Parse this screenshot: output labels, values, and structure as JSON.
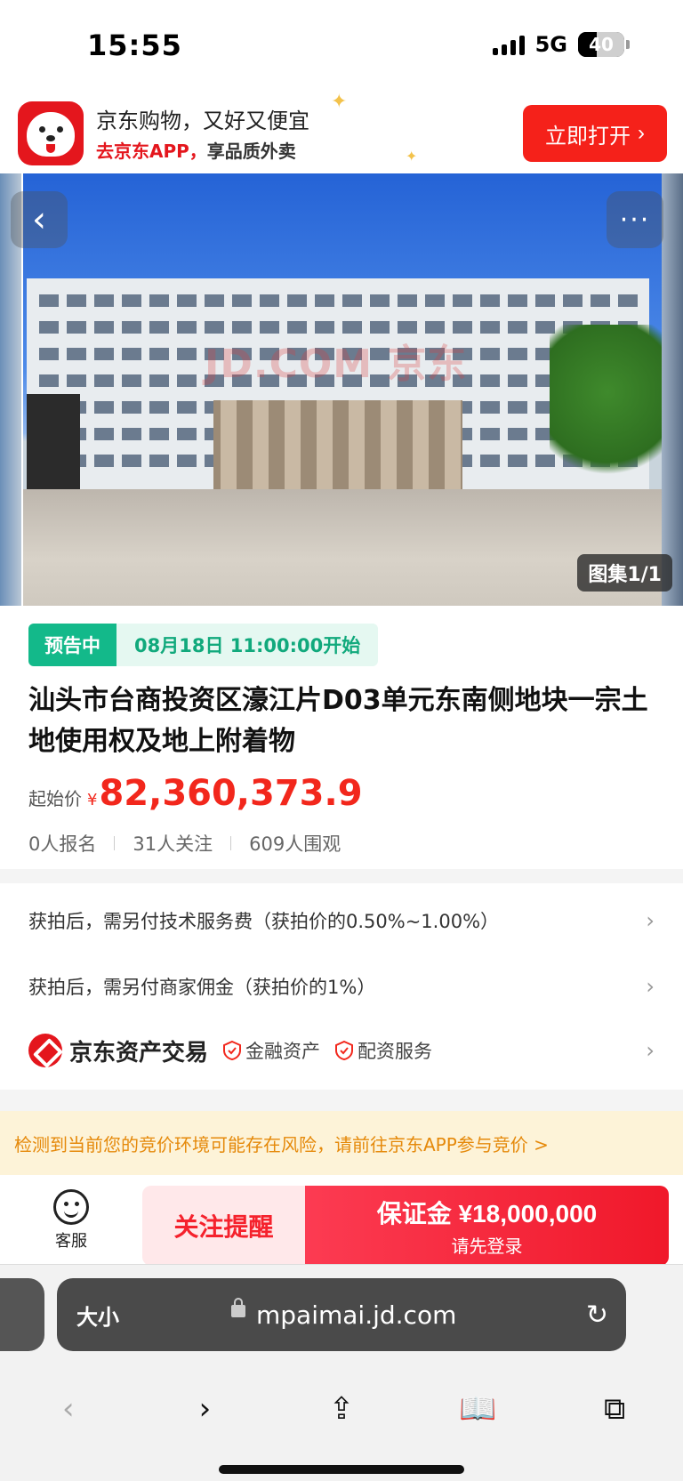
{
  "status_bar": {
    "time": "15:55",
    "network": "5G",
    "battery": "40",
    "battery_level": 0.4
  },
  "app_banner": {
    "title": "京东购物，又好又便宜",
    "subtitle_highlight": "去京东APP，",
    "subtitle_rest": "享品质外卖",
    "open_label": "立即打开",
    "open_chevron": "›"
  },
  "hero": {
    "back_icon": "‹",
    "more_icon": "···",
    "watermark": "JD.COM 京东",
    "gallery_label": "图集1/1"
  },
  "auction": {
    "status": "预告中",
    "start_time": "08月18日 11:00:00开始",
    "title": "汕头市台商投资区濠江片D03单元东南侧地块一宗土地使用权及地上附着物",
    "price_label": "起始价",
    "currency": "¥",
    "price": "82,360,373.9",
    "stats": [
      "0人报名",
      "31人关注",
      "609人围观"
    ]
  },
  "fees": [
    {
      "text": "获拍后，需另付技术服务费（获拍价的0.50%~1.00%）",
      "chevron": "›"
    },
    {
      "text": "获拍后，需另付商家佣金（获拍价的1%）",
      "chevron": "›"
    }
  ],
  "brand": {
    "name": "京东资产交易",
    "badges": [
      "金融资产",
      "配资服务"
    ],
    "chevron": "›"
  },
  "risk_warning": "检测到当前您的竞价环境可能存在风险，请前往京东APP参与竞价 >",
  "action_bar": {
    "service_label": "客服",
    "follow_label": "关注提醒",
    "deposit_label": "保证金 ¥18,000,000",
    "deposit_sub": "请先登录"
  },
  "browser": {
    "size_label": "大小",
    "domain": "mpaimai.jd.com",
    "reload_icon": "↻",
    "nav": {
      "back": "‹",
      "forward": "›",
      "share": "⇪",
      "bookmarks": "📖",
      "tabs": "⧉"
    }
  },
  "colors": {
    "jd_red": "#e4161d",
    "price_red": "#f2271c",
    "status_green": "#13b98a",
    "warning_orange": "#e5890a"
  }
}
